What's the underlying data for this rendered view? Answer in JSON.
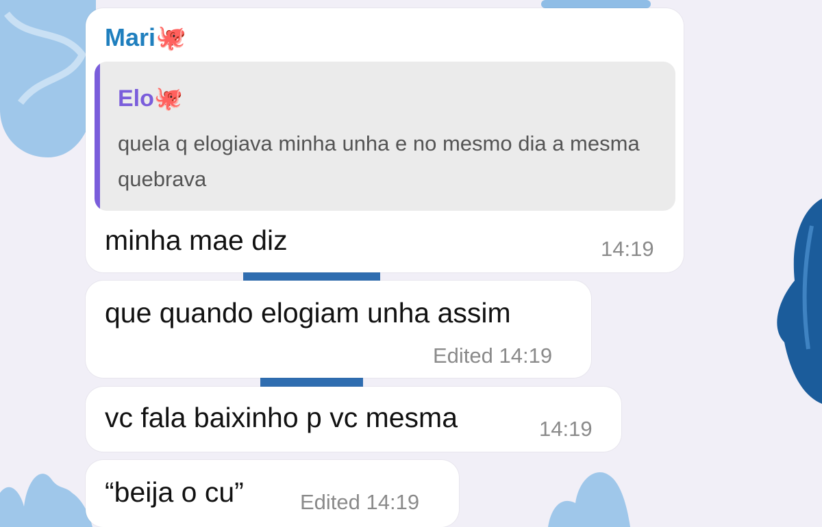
{
  "colors": {
    "background": "#f1eff7",
    "bubble": "#ffffff",
    "sender_name": "#1f7fbe",
    "reply_accent": "#7a5ddb",
    "reply_background": "#ebebeb",
    "meta_text": "#8a8a8a"
  },
  "messages": [
    {
      "sender": "Mari",
      "sender_emoji": "🐙",
      "reply": {
        "name": "Elo",
        "emoji": "🐙",
        "text": "quela q elogiava minha unha e no mesmo dia a mesma quebrava"
      },
      "text": "minha mae diz",
      "edited_label": "",
      "time": "14:19"
    },
    {
      "text": "que quando elogiam unha assim",
      "edited_label": "Edited",
      "time": "14:19"
    },
    {
      "text": "vc fala baixinho p vc mesma",
      "edited_label": "",
      "time": "14:19"
    },
    {
      "text": "“beija o cu”",
      "edited_label": "Edited",
      "time": "14:19"
    }
  ]
}
